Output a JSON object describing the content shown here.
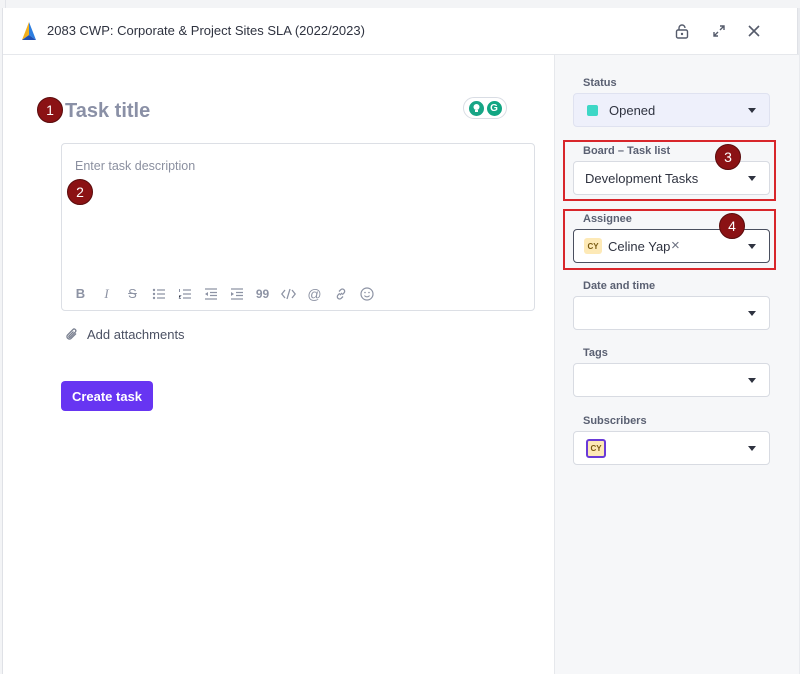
{
  "header": {
    "title": "2083 CWP: Corporate & Project Sites SLA (2022/2023)",
    "icons": [
      "app-logo-icon",
      "lock-icon",
      "expand-icon",
      "close-icon"
    ]
  },
  "editor": {
    "title_placeholder": "Task title",
    "description_placeholder": "Enter task description",
    "toolbar": [
      "B",
      "I",
      "S",
      "bullet-list",
      "numbered-list",
      "outdent",
      "indent",
      "99",
      "code",
      "@",
      "link",
      "emoji"
    ]
  },
  "attachments_label": "Add attachments",
  "create_button": "Create task",
  "sidebar": {
    "status_label": "Status",
    "status_value": "Opened",
    "board_label": "Board – Task list",
    "board_value": "Development Tasks",
    "assignee_label": "Assignee",
    "assignee_initials": "CY",
    "assignee_name": "Celine Yap",
    "date_label": "Date and time",
    "tags_label": "Tags",
    "subscribers_label": "Subscribers",
    "subscriber_initials": "CY"
  },
  "annotations": [
    "1",
    "2",
    "3",
    "4"
  ],
  "colors": {
    "accent": "#6735f2",
    "status": "#3dd7c6",
    "highlight": "#d8262b",
    "badge": "#8b1214"
  }
}
